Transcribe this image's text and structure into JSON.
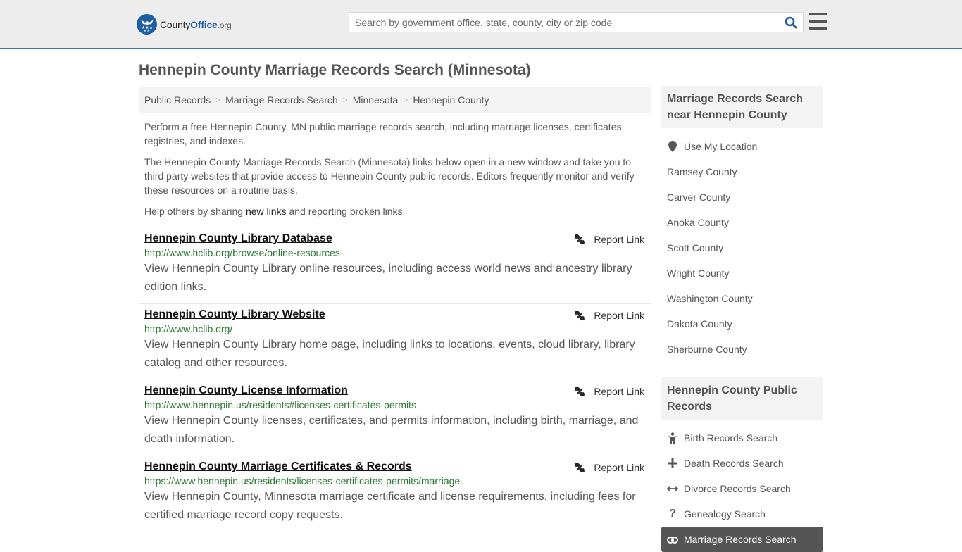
{
  "header": {
    "logo": {
      "name": "County",
      "name_accent": "Office",
      "tld": ".org"
    },
    "search": {
      "placeholder": "Search by government office, state, county, city or zip code",
      "value": ""
    },
    "colors": {
      "accent": "#3c78a8",
      "brand": "#1e5fa3",
      "url_green": "#287a2f"
    }
  },
  "page": {
    "title": "Hennepin County Marriage Records Search (Minnesota)",
    "breadcrumb": [
      {
        "label": "Public Records"
      },
      {
        "label": "Marriage Records Search"
      },
      {
        "label": "Minnesota"
      },
      {
        "label": "Hennepin County"
      }
    ],
    "breadcrumb_separator": ">",
    "intro": [
      "Perform a free Hennepin County, MN public marriage records search, including marriage licenses, certificates, registries, and indexes.",
      "The Hennepin County Marriage Records Search (Minnesota) links below open in a new window and take you to third party websites that provide access to Hennepin County public records. Editors frequently monitor and verify these resources on a routine basis."
    ],
    "help": {
      "prefix": "Help others by sharing ",
      "link": "new links",
      "suffix": " and reporting broken links."
    }
  },
  "results": [
    {
      "title": "Hennepin County Library Database",
      "url": "http://www.hclib.org/browse/online-resources",
      "description": "View Hennepin County Library online resources, including access world news and ancestry library edition links.",
      "report_label": "Report Link"
    },
    {
      "title": "Hennepin County Library Website",
      "url": "http://www.hclib.org/",
      "description": "View Hennepin County Library home page, including links to locations, events, cloud library, library catalog and other resources.",
      "report_label": "Report Link"
    },
    {
      "title": "Hennepin County License Information",
      "url": "http://www.hennepin.us/residents#licenses-certificates-permits",
      "description": "View Hennepin County licenses, certificates, and permits information, including birth, marriage, and death information.",
      "report_label": "Report Link"
    },
    {
      "title": "Hennepin County Marriage Certificates & Records",
      "url": "https://www.hennepin.us/residents/licenses-certificates-permits/marriage",
      "description": "View Hennepin County, Minnesota marriage certificate and license requirements, including fees for certified marriage record copy requests.",
      "report_label": "Report Link"
    }
  ],
  "sidebar": {
    "nearby": {
      "heading": "Marriage Records Search near Hennepin County",
      "use_location": {
        "label": "Use My Location",
        "icon": "map-marker-icon"
      },
      "items": [
        {
          "label": "Ramsey County"
        },
        {
          "label": "Carver County"
        },
        {
          "label": "Anoka County"
        },
        {
          "label": "Scott County"
        },
        {
          "label": "Wright County"
        },
        {
          "label": "Washington County"
        },
        {
          "label": "Dakota County"
        },
        {
          "label": "Sherburne County"
        }
      ]
    },
    "public_records": {
      "heading": "Hennepin County Public Records",
      "items": [
        {
          "label": "Birth Records Search",
          "icon": "child-icon"
        },
        {
          "label": "Death Records Search",
          "icon": "plus-icon"
        },
        {
          "label": "Divorce Records Search",
          "icon": "arrows-horizontal-icon"
        },
        {
          "label": "Genealogy Search",
          "icon": "question-icon"
        },
        {
          "label": "Marriage Records Search",
          "icon": "rings-icon",
          "active": true
        }
      ]
    }
  }
}
